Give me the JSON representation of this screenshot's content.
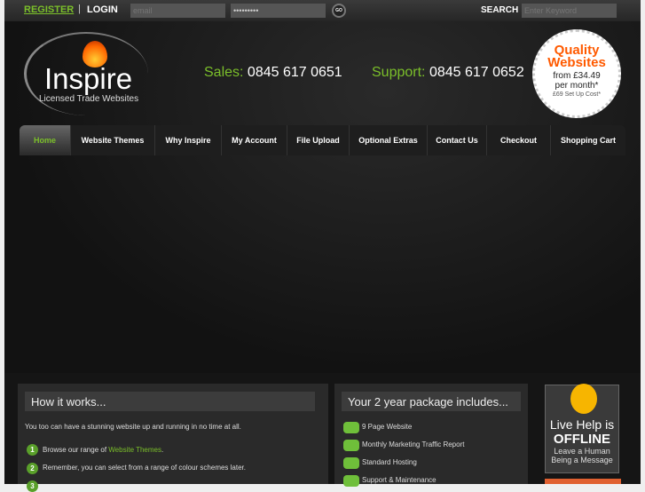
{
  "topbar": {
    "register": "REGISTER",
    "separator": "|",
    "login": "LOGIN",
    "email_placeholder": "email",
    "password_value": "•••••••••",
    "go": "GO",
    "search_label": "SEARCH",
    "search_placeholder": "Enter Keyword"
  },
  "logo": {
    "title": "Inspire",
    "subtitle": "Licensed Trade Websites"
  },
  "contact": {
    "sales_label": "Sales:",
    "sales_number": "0845 617 0651",
    "support_label": "Support:",
    "support_number": "0845 617 0652"
  },
  "badge": {
    "line1": "Quality",
    "line2": "Websites",
    "line3": "from £34.49",
    "line4": "per month*",
    "line5": "£69 Set Up Cost*"
  },
  "nav": [
    "Home",
    "Website Themes",
    "Why Inspire",
    "My Account",
    "File Upload",
    "Optional Extras",
    "Contact Us",
    "Checkout",
    "Shopping Cart"
  ],
  "how": {
    "title": "How it works...",
    "intro": "You too can have a stunning website up and running in no time at all.",
    "step1_pre": "Browse our range of ",
    "step1_link": "Website Themes",
    "step1_post": ".",
    "step2": "Remember, you can select from a range of colour schemes later.",
    "nums": [
      "1",
      "2",
      "3"
    ]
  },
  "package": {
    "title": "Your 2 year package includes...",
    "items": [
      "9 Page Website",
      "Monthly Marketing Traffic Report",
      "Standard Hosting",
      "Support & Maintenance"
    ]
  },
  "livehelp": {
    "line1": "Live Help is",
    "line2": "OFFLINE",
    "line3": "Leave a Human",
    "line4": "Being a Message"
  }
}
